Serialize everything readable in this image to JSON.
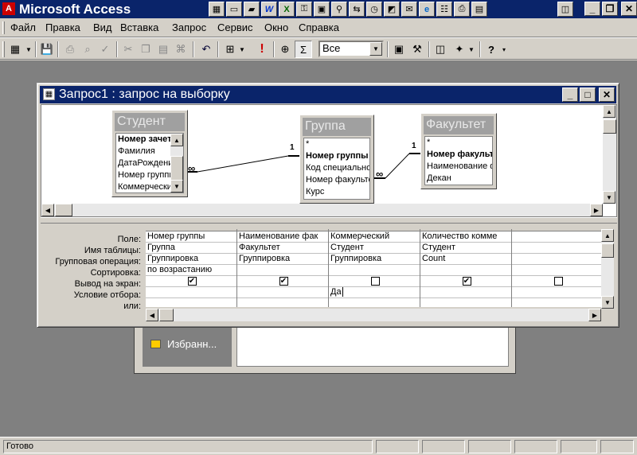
{
  "app": {
    "title": "Microsoft Access",
    "controls": {
      "minimize": "_",
      "restore": "❐",
      "close": "✕"
    }
  },
  "menu": [
    "Файл",
    "Правка",
    "Вид",
    "Вставка",
    "Запрос",
    "Сервис",
    "Окно",
    "Справка"
  ],
  "toolbar": {
    "top_values_combo": "Все",
    "icons": [
      "datasheet-view-icon",
      "save-icon",
      "print-icon",
      "print-preview-icon",
      "spelling-icon",
      "cut-icon",
      "copy-icon",
      "paste-icon",
      "format-painter-icon",
      "undo-icon",
      "query-type-icon",
      "run-icon",
      "show-table-icon",
      "totals-icon",
      "properties-icon",
      "build-icon",
      "database-window-icon",
      "new-object-icon",
      "help-icon"
    ]
  },
  "query_window": {
    "title": "Запрос1 : запрос на выборку"
  },
  "tables": [
    {
      "name": "Студент",
      "fields": [
        "Номер зачетки",
        "Фамилия",
        "ДатаРождения",
        "Номер группы",
        "Коммерческий"
      ],
      "key_field_index": 0
    },
    {
      "name": "Группа",
      "fields": [
        "*",
        "Номер группы",
        "Код специальности",
        "Номер факультета",
        "Курс"
      ],
      "key_field_index": 1
    },
    {
      "name": "Факультет",
      "fields": [
        "*",
        "Номер факультета",
        "Наименование ф",
        "Декан"
      ],
      "key_field_index": 1
    }
  ],
  "joins": [
    {
      "one": "1",
      "many": "∞"
    },
    {
      "one": "1",
      "many": "∞"
    }
  ],
  "qbe": {
    "row_labels": [
      "Поле:",
      "Имя таблицы:",
      "Групповая операция:",
      "Сортировка:",
      "Вывод на экран:",
      "Условие отбора:",
      "или:"
    ],
    "columns": [
      {
        "field": "Номер группы",
        "table": "Группа",
        "total": "Группировка",
        "sort": "по возрастанию",
        "show": true,
        "criteria": "",
        "or": ""
      },
      {
        "field": "Наименование фак",
        "table": "Факультет",
        "total": "Группировка",
        "sort": "",
        "show": true,
        "criteria": "",
        "or": ""
      },
      {
        "field": "Коммерческий",
        "table": "Студент",
        "total": "Группировка",
        "sort": "",
        "show": false,
        "criteria": "Да",
        "or": ""
      },
      {
        "field": "Количество комме",
        "table": "Студент",
        "total": "Count",
        "sort": "",
        "show": true,
        "criteria": "",
        "or": ""
      },
      {
        "field": "",
        "table": "",
        "total": "",
        "sort": "",
        "show": false,
        "criteria": "",
        "or": ""
      }
    ]
  },
  "db_window": {
    "group_item": "Избранн..."
  },
  "status": {
    "text": "Готово"
  },
  "colors": {
    "title_bar": "#0a246a",
    "face": "#d4d0c8",
    "mdi": "#808080"
  }
}
